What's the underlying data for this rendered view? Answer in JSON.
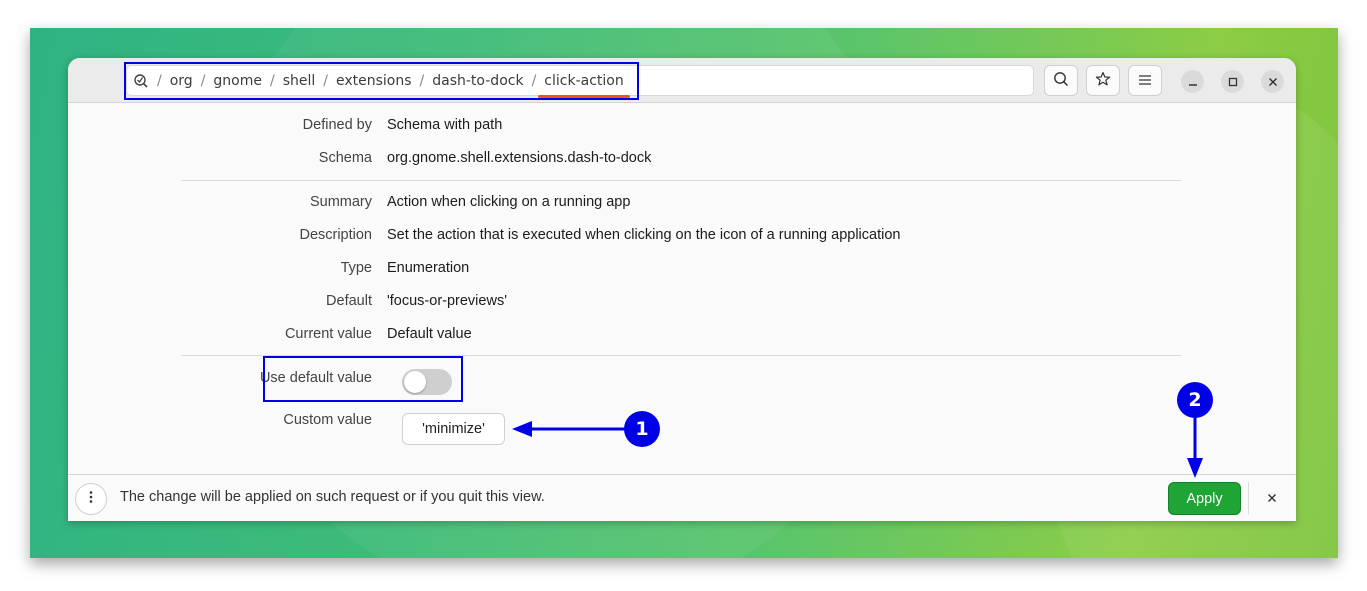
{
  "header": {
    "path_icon": "dconf-search-icon",
    "path_segments": [
      "org",
      "gnome",
      "shell",
      "extensions",
      "dash-to-dock",
      "click-action"
    ],
    "path_separator": "/",
    "active_segment": "click-action",
    "buttons": {
      "search_icon": "search-icon",
      "bookmark_icon": "star-icon",
      "menu_icon": "hamburger-menu-icon"
    },
    "window_controls": {
      "minimize": "minimize-icon",
      "maximize": "maximize-icon",
      "close": "close-icon"
    }
  },
  "details": {
    "defined_by": {
      "label": "Defined by",
      "value": "Schema with path"
    },
    "schema": {
      "label": "Schema",
      "value": "org.gnome.shell.extensions.dash-to-dock"
    },
    "summary": {
      "label": "Summary",
      "value": "Action when clicking on a running app"
    },
    "description": {
      "label": "Description",
      "value": "Set the action that is executed when clicking on the icon of a running application"
    },
    "type": {
      "label": "Type",
      "value": "Enumeration"
    },
    "default": {
      "label": "Default",
      "value": "'focus-or-previews'"
    },
    "current_value": {
      "label": "Current value",
      "value": "Default value"
    }
  },
  "edit": {
    "use_default_label": "Use default value",
    "use_default_enabled": false,
    "custom_value_label": "Custom value",
    "custom_value": "'minimize'"
  },
  "bottombar": {
    "message": "The change will be applied on such request or if you quit this view.",
    "apply_label": "Apply",
    "dismiss_icon": "close-icon",
    "menu_icon": "vertical-dots-icon"
  },
  "annotations": {
    "badge1": "1",
    "badge2": "2",
    "color": "#0000e6"
  },
  "colors": {
    "accent_underline": "#e95420",
    "apply_green": "#1ea536",
    "annotation_blue": "#0000e6"
  }
}
